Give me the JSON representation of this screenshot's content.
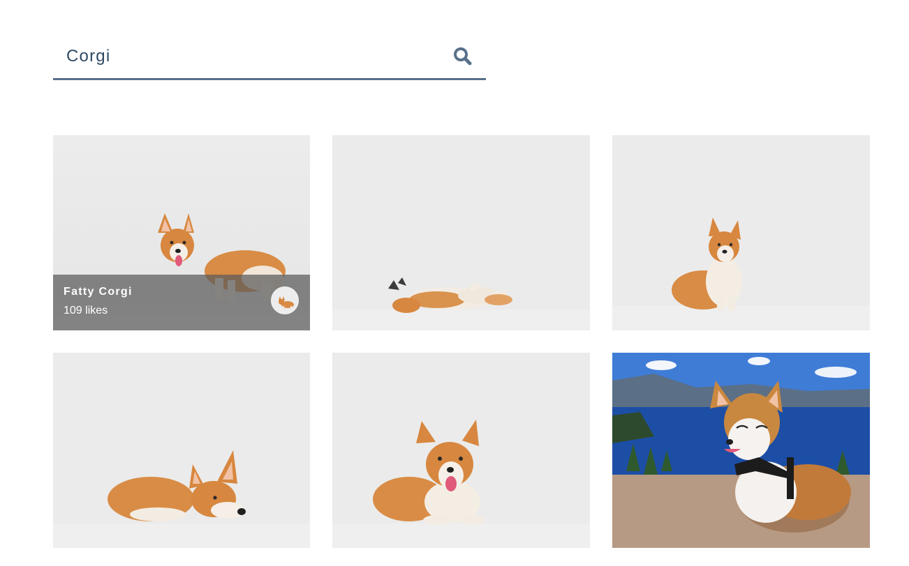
{
  "search": {
    "value": "Corgi",
    "icon": "search-icon",
    "color": "#58718a"
  },
  "results": [
    {
      "title": "Fatty Corgi",
      "likes": "109 likes",
      "hovered": true
    },
    {
      "pose": "rolling-on-back"
    },
    {
      "pose": "sitting"
    },
    {
      "pose": "lying-head-down"
    },
    {
      "pose": "lying-smiling"
    },
    {
      "pose": "outdoors-lake"
    }
  ]
}
